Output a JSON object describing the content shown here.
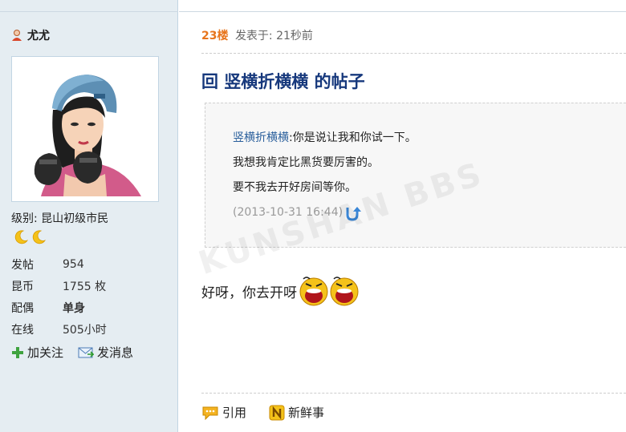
{
  "user": {
    "name": "尤尤",
    "level_label": "级别: ",
    "level_value": "昆山初级市民",
    "stats": [
      {
        "key": "发帖",
        "value": "954",
        "bold": false
      },
      {
        "key": "昆币",
        "value": "1755 枚",
        "bold": false
      },
      {
        "key": "配偶",
        "value": "单身",
        "bold": true
      },
      {
        "key": "在线",
        "value": "505小时",
        "bold": false
      }
    ],
    "follow_label": "加关注",
    "message_label": "发消息"
  },
  "post": {
    "floor": "23楼",
    "posted_label": "发表于: 21秒前",
    "title": "回 竖横折横横 的帖子",
    "quote": {
      "author": "竖横折横横",
      "line1": ":你是说让我和你试一下。",
      "line2": "我想我肯定比黑货要厉害的。",
      "line3": "要不我去开好房间等你。",
      "time": "(2013-10-31 16:44)"
    },
    "reply_text": "好呀，你去开呀",
    "quote_label": "引用",
    "news_label": "新鲜事"
  },
  "watermark": "KUNSHAN BBS",
  "colors": {
    "link_blue": "#16387c",
    "floor_orange": "#e7741b",
    "sidebar_bg": "#e5edf2"
  }
}
